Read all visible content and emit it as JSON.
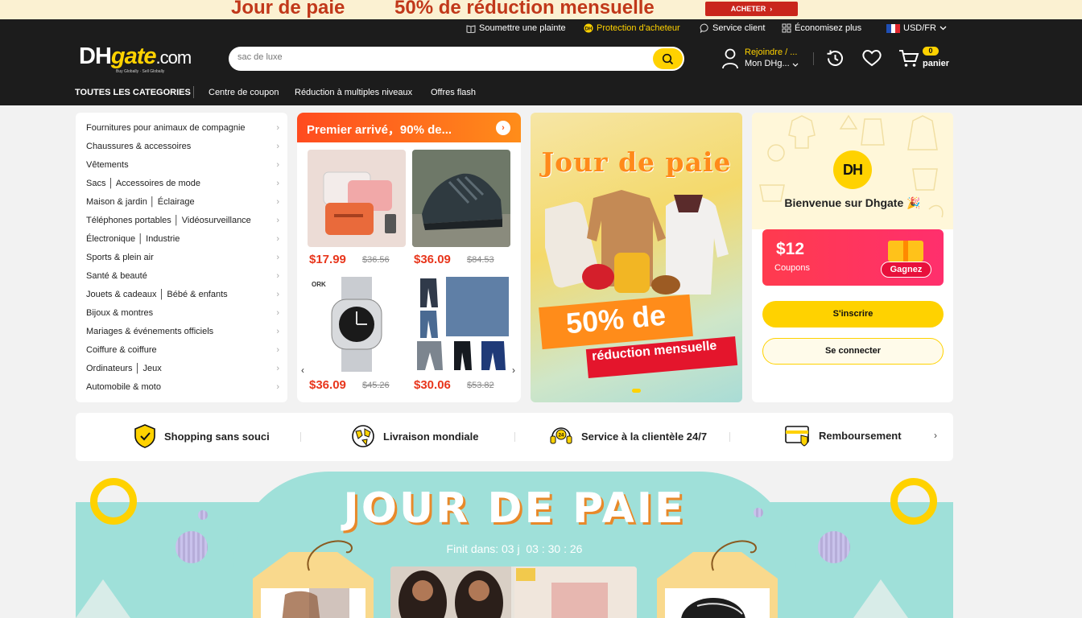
{
  "promo": {
    "left_text": "Jour de paie",
    "right_text": "50% de réduction mensuelle",
    "button": "ACHETER",
    "button_arrow": "›"
  },
  "topbar": {
    "complaint": "Soumettre une plainte",
    "protection": "Protection d'acheteur",
    "service": "Service client",
    "save": "Économisez plus",
    "currency": "USD/FR"
  },
  "header": {
    "logo_dh": "DH",
    "logo_gate": "gate",
    "logo_com": ".com",
    "logo_tagline": "Buy Globally · Sell Globally",
    "search_placeholder": "sac de luxe",
    "account_line1": "Rejoindre / ...",
    "account_line2": "Mon DHg...",
    "cart_count": "0",
    "cart_label": "panier"
  },
  "nav": {
    "all_categories": "TOUTES LES CATEGORIES",
    "links": [
      "Centre de coupon",
      "Réduction à multiples niveaux",
      "Offres flash"
    ]
  },
  "categories": [
    "Fournitures pour animaux de compagnie",
    "Chaussures & accessoires",
    "Vêtements",
    "Sacs │ Accessoires de mode",
    "Maison & jardin │ Éclairage",
    "Téléphones portables │ Vidéosurveillance",
    "Électronique │ Industrie",
    "Sports & plein air",
    "Santé & beauté",
    "Jouets & cadeaux │ Bébé & enfants",
    "Bijoux & montres",
    "Mariages & événements officiels",
    "Coiffure & coiffure",
    "Ordinateurs │ Jeux",
    "Automobile & moto"
  ],
  "flash": {
    "title": "Premier arrivé，90% de...",
    "products": [
      {
        "price": "$17.99",
        "old": "$36.56",
        "icon": "cosmetic-bag"
      },
      {
        "price": "$36.09",
        "old": "$84.53",
        "icon": "sneaker"
      },
      {
        "price": "$36.09",
        "old": "$45.26",
        "icon": "wristwatch"
      },
      {
        "price": "$30.06",
        "old": "$53.82",
        "icon": "jeans"
      }
    ]
  },
  "banner": {
    "title": "Jour de paie",
    "percent": "50% de",
    "subtitle": "réduction mensuelle"
  },
  "welcome": {
    "avatar": "DH",
    "greeting": "Bienvenue sur Dhgate 🎉",
    "coupon_amount": "$12",
    "coupon_label": "Coupons",
    "gain": "Gagnez",
    "join": "S'inscrire",
    "login": "Se connecter"
  },
  "benefits": [
    {
      "label": "Shopping sans souci",
      "icon": "shield-icon"
    },
    {
      "label": "Livraison mondiale",
      "icon": "globe-icon"
    },
    {
      "label": "Service à la clientèle 24/7",
      "icon": "headset-icon"
    },
    {
      "label": "Remboursement",
      "icon": "card-icon"
    }
  ],
  "payday": {
    "title": "JOUR DE PAIE",
    "countdown": "Finit dans: 03 j  03 : 30 : 26"
  },
  "colors": {
    "brand_yellow": "#ffd200",
    "header_dark": "#1c1c1c",
    "price_red": "#e8361c",
    "payday_teal": "#9fe0d9"
  }
}
